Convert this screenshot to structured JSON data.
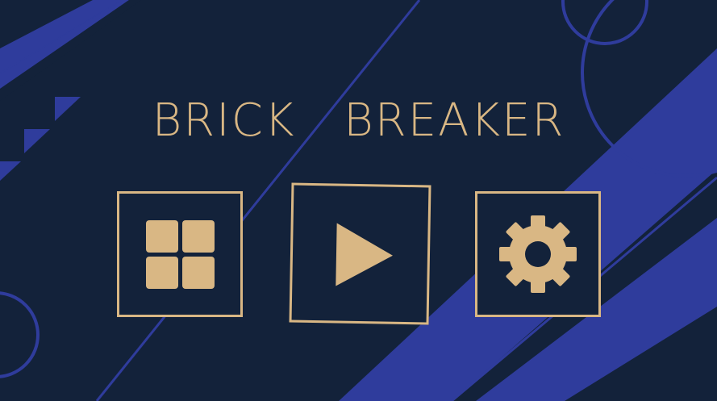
{
  "game": {
    "title": "BRICK  BREAKER"
  },
  "menu": {
    "buttons": [
      {
        "id": "levels",
        "icon": "grid-icon"
      },
      {
        "id": "play",
        "icon": "play-icon"
      },
      {
        "id": "settings",
        "icon": "gear-icon"
      }
    ]
  },
  "colors": {
    "background": "#13223a",
    "stripe": "#2f3c9c",
    "accent": "#d9b784"
  }
}
